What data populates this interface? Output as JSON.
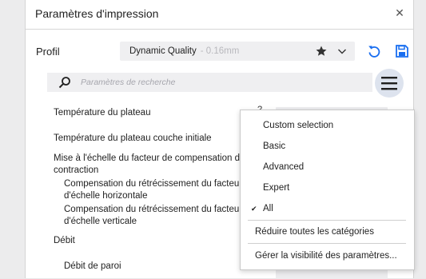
{
  "dialog": {
    "title": "Paramètres d'impression",
    "close_glyph": "✕"
  },
  "profile": {
    "label": "Profil",
    "name": "Dynamic Quality",
    "quality": "- 0.16mm"
  },
  "search": {
    "placeholder": "Paramètres de recherche"
  },
  "settings": {
    "plate_temp": "Température du plateau",
    "plate_temp_initial": "Température du plateau couche initiale",
    "scale_line1": "Mise à l'échelle du facteur de compensation de",
    "scale_line2": "contraction",
    "comp_h_line1": "Compensation du rétrécissement du facteur",
    "comp_h_line2": "d'échelle horizontale",
    "comp_v_line1": "Compensation du rétrécissement du facteur",
    "comp_v_line2": "d'échelle verticale",
    "flow": "Débit",
    "wall_flow": "Débit de paroi",
    "hidden_glyph": "?"
  },
  "visibility_menu": {
    "items": [
      {
        "label": "Custom selection",
        "checked": false
      },
      {
        "label": "Basic",
        "checked": false
      },
      {
        "label": "Advanced",
        "checked": false
      },
      {
        "label": "Expert",
        "checked": false
      },
      {
        "label": "All",
        "checked": true
      }
    ],
    "check_glyph": "✔",
    "collapse_all": "Réduire toutes les catégories",
    "manage_visibility": "Gérer la visibilité des paramètres..."
  },
  "colors": {
    "accent": "#196ef0",
    "menu_button_bg": "#dde3ee"
  },
  "icons": [
    "close-icon",
    "star-icon",
    "chevron-down-icon",
    "undo-icon",
    "save-icon",
    "search-icon",
    "hamburger-icon",
    "check-icon"
  ]
}
